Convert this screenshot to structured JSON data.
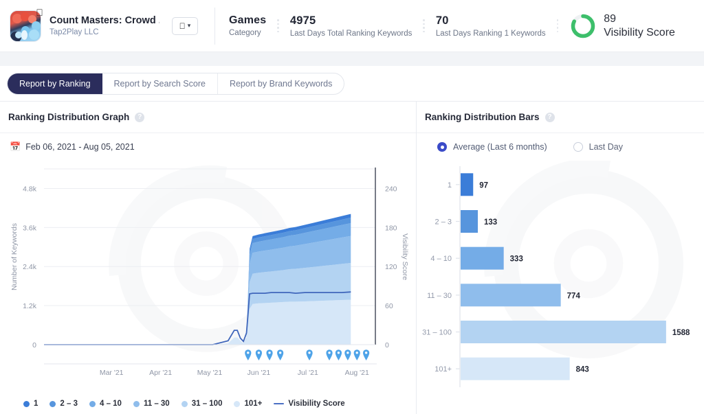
{
  "header": {
    "app_name": "Count Masters: Crowd ...",
    "developer": "Tap2Play LLC",
    "app_icon_name": "app-icon-count-masters",
    "platform_selector": {
      "icon": "apple-icon",
      "chevron": "chevron-down-icon"
    },
    "metrics": [
      {
        "value": "Games",
        "label": "Category"
      },
      {
        "value": "4975",
        "label": "Last Days Total Ranking Keywords"
      },
      {
        "value": "70",
        "label": "Last Days Ranking 1 Keywords"
      }
    ],
    "visibility": {
      "value": "89",
      "label": "Visibility Score",
      "ring_percent": 89,
      "ring_color": "#3dbf6b",
      "ring_track": "#edf1f3"
    }
  },
  "tabs": [
    {
      "label": "Report by Ranking",
      "active": true
    },
    {
      "label": "Report by Search Score",
      "active": false
    },
    {
      "label": "Report by Brand Keywords",
      "active": false
    }
  ],
  "left_panel": {
    "title": "Ranking Distribution Graph",
    "help": "?",
    "date_range": "Feb 06, 2021 - Aug 05, 2021",
    "calendar_icon": "calendar-icon"
  },
  "right_panel": {
    "title": "Ranking Distribution Bars",
    "help": "?",
    "options": [
      {
        "label": "Average (Last 6 months)",
        "selected": true
      },
      {
        "label": "Last Day",
        "selected": false
      }
    ]
  },
  "chart_data": [
    {
      "type": "area",
      "id": "ranking-distribution-graph",
      "title": "Ranking Distribution Graph",
      "subtitle": "Feb 06, 2021 - Aug 05, 2021",
      "xlabel": "",
      "ylabel": "Number of Keywords",
      "y2label": "Visibility Score",
      "xticks": [
        "Mar '21",
        "Apr '21",
        "May '21",
        "Jun '21",
        "Jul '21",
        "Aug '21"
      ],
      "yticks": [
        "0",
        "1.2k",
        "2.4k",
        "3.6k",
        "4.8k"
      ],
      "ylim": [
        0,
        5400
      ],
      "y2ticks": [
        "0",
        "60",
        "120",
        "180",
        "240"
      ],
      "y2lim": [
        0,
        270
      ],
      "grid": true,
      "stacked": true,
      "legend_position": "bottom",
      "x": [
        0,
        5,
        10,
        15,
        20,
        25,
        30,
        35,
        40,
        45,
        50,
        55,
        60,
        62,
        63,
        64,
        65,
        66,
        67,
        68,
        70,
        72,
        74,
        76,
        78,
        80,
        82,
        85,
        88,
        91,
        94,
        97,
        100
      ],
      "series": [
        {
          "name": "101+",
          "color": "#d6e7f8",
          "values": [
            0,
            0,
            0,
            0,
            0,
            0,
            0,
            0,
            0,
            0,
            0,
            0,
            40,
            220,
            220,
            120,
            40,
            180,
            1100,
            1250,
            1270,
            1280,
            1290,
            1300,
            1310,
            1320,
            1320,
            1330,
            1340,
            1350,
            1360,
            1370,
            1380
          ]
        },
        {
          "name": "31 – 100",
          "color": "#b3d3f2",
          "values": [
            0,
            0,
            0,
            0,
            0,
            0,
            0,
            0,
            0,
            0,
            0,
            0,
            0,
            0,
            0,
            0,
            0,
            10,
            820,
            930,
            940,
            950,
            960,
            970,
            980,
            1000,
            1010,
            1030,
            1050,
            1070,
            1090,
            1110,
            1130
          ]
        },
        {
          "name": "11 – 30",
          "color": "#8fbdec",
          "values": [
            0,
            0,
            0,
            0,
            0,
            0,
            0,
            0,
            0,
            0,
            0,
            0,
            0,
            0,
            0,
            0,
            0,
            5,
            560,
            640,
            650,
            660,
            670,
            680,
            690,
            700,
            710,
            730,
            750,
            770,
            790,
            810,
            830
          ]
        },
        {
          "name": "4 – 10",
          "color": "#74ace7",
          "values": [
            0,
            0,
            0,
            0,
            0,
            0,
            0,
            0,
            0,
            0,
            0,
            0,
            0,
            0,
            0,
            0,
            0,
            3,
            270,
            300,
            305,
            310,
            315,
            320,
            325,
            330,
            335,
            345,
            355,
            365,
            375,
            385,
            395
          ]
        },
        {
          "name": "2 – 3",
          "color": "#5795dd",
          "values": [
            0,
            0,
            0,
            0,
            0,
            0,
            0,
            0,
            0,
            0,
            0,
            0,
            0,
            0,
            0,
            0,
            0,
            2,
            110,
            125,
            128,
            130,
            132,
            134,
            136,
            138,
            140,
            145,
            150,
            155,
            160,
            165,
            170
          ]
        },
        {
          "name": "1",
          "color": "#3b7dd8",
          "values": [
            0,
            0,
            0,
            0,
            0,
            0,
            0,
            0,
            0,
            0,
            0,
            0,
            0,
            0,
            0,
            0,
            0,
            2,
            80,
            90,
            92,
            94,
            95,
            96,
            97,
            98,
            99,
            101,
            103,
            105,
            107,
            109,
            111
          ]
        }
      ],
      "visibility_line": {
        "name": "Visibility Score",
        "color": "#3f66bb",
        "axis": "right",
        "values": [
          0,
          0,
          0,
          0,
          0,
          0,
          0,
          0,
          0,
          0,
          0,
          0,
          6,
          22,
          22,
          10,
          5,
          18,
          78,
          79,
          79,
          79,
          80,
          80,
          80,
          80,
          79,
          80,
          80,
          80,
          80,
          80,
          81
        ]
      },
      "markers": {
        "icon": "map-pin-icon",
        "color": "#4ea3e8",
        "x": [
          66.5,
          70,
          73.5,
          77,
          86.5,
          93,
          96,
          99,
          102,
          105
        ]
      },
      "legend": [
        "1",
        "2 – 3",
        "4 – 10",
        "11 – 30",
        "31 – 100",
        "101+",
        "Visibility Score"
      ]
    },
    {
      "type": "bar",
      "id": "ranking-distribution-bars",
      "title": "Ranking Distribution Bars",
      "orientation": "horizontal",
      "xlabel": "",
      "ylabel": "",
      "categories": [
        "1",
        "2 – 3",
        "4 – 10",
        "11 – 30",
        "31 – 100",
        "101+"
      ],
      "values": [
        97,
        133,
        333,
        774,
        1588,
        843
      ],
      "colors": [
        "#3b7dd8",
        "#5795dd",
        "#74ace7",
        "#8fbdec",
        "#b3d3f2",
        "#d6e7f8"
      ],
      "xlim": [
        0,
        1780
      ],
      "grid": false,
      "data_labels": true
    }
  ],
  "legend": [
    {
      "label": "1",
      "color": "#3b7dd8",
      "shape": "dot"
    },
    {
      "label": "2 – 3",
      "color": "#5795dd",
      "shape": "dot"
    },
    {
      "label": "4 – 10",
      "color": "#74ace7",
      "shape": "dot"
    },
    {
      "label": "11 – 30",
      "color": "#8fbdec",
      "shape": "dot"
    },
    {
      "label": "31 – 100",
      "color": "#b3d3f2",
      "shape": "dot"
    },
    {
      "label": "101+",
      "color": "#d6e7f8",
      "shape": "dot"
    },
    {
      "label": "Visibility Score",
      "color": "#4a6fc4",
      "shape": "line"
    }
  ]
}
